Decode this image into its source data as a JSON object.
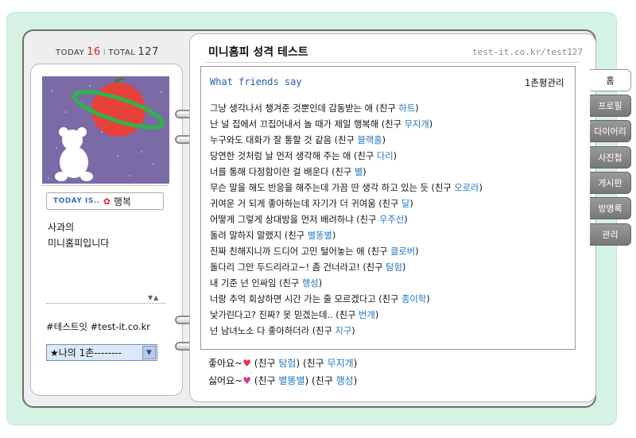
{
  "counter": {
    "today_label": "TODAY",
    "today_value": "16",
    "separator": "I",
    "total_label": "TOTAL",
    "total_value": "127"
  },
  "profile": {
    "today_is_label": "TODAY IS..",
    "mood_icon": "flower-icon",
    "mood": "행복",
    "intro_line1": "사과의",
    "intro_line2": "미니홈피입니다",
    "arrows": "▼▲",
    "tags": "#테스트잇 #test-it.co.kr",
    "ilchon_select": "★나의 1촌--------"
  },
  "header": {
    "title": "미니홈피 성격 테스트",
    "url": "test-it.co.kr/test127"
  },
  "main": {
    "section_title": "What friends say",
    "review_link": "1촌평관리",
    "lines": [
      {
        "text": "그냥 생각나서 챙겨준 것뿐인데 감동받는 애 (친구 ",
        "friend": "하트",
        "end": ")"
      },
      {
        "text": "난 널 집에서 끄집어내서 놀 때가 제일 행복해 (친구 ",
        "friend": "무지개",
        "end": ")"
      },
      {
        "text": "누구와도 대화가 잘 통할 것 같음 (친구 ",
        "friend": "블랙홀",
        "end": ")"
      },
      {
        "text": "당연한 것처럼 날 먼저 생각해 주는 애 (친구 ",
        "friend": "다리",
        "end": ")"
      },
      {
        "text": "너를 통해 다정함이란 걸 배운다 (친구 ",
        "friend": "별",
        "end": ")"
      },
      {
        "text": "무슨 말을 해도 반응을 해주는데 가끔 딴 생각 하고 있는 듯 (친구 ",
        "friend": "오로라",
        "end": ")"
      },
      {
        "text": "귀여운 거 되게 좋아하는데 자기가 더 귀여움 (친구 ",
        "friend": "달",
        "end": ")"
      },
      {
        "text": "어떻게 그렇게 상대방을 먼저 배려하냐 (친구 ",
        "friend": "우주선",
        "end": ")"
      },
      {
        "text": "돌려 말하지 말랬지 (친구 ",
        "friend": "별똥별",
        "end": ")"
      },
      {
        "text": "진짜 친해지니까 드디어 고민 털어놓는 애 (친구 ",
        "friend": "클로버",
        "end": ")"
      },
      {
        "text": "돌다리 그만 두드리라고~! 좀 건너라고! (친구 ",
        "friend": "탐험",
        "end": ")"
      },
      {
        "text": "내 기준 넌 인싸임 (친구 ",
        "friend": "행성",
        "end": ")"
      },
      {
        "text": "너랑 추억 회상하면 시간 가는 줄 모르겠다고 (친구 ",
        "friend": "종이학",
        "end": ")"
      },
      {
        "text": "낯가린다고? 진짜? 못 믿겠는데.. (친구 ",
        "friend": "번개",
        "end": ")"
      },
      {
        "text": "넌 남녀노소 다 좋아하더라 (친구 ",
        "friend": "지구",
        "end": ")"
      }
    ],
    "like_label": "좋아요~",
    "like_icon": "heart-icon",
    "like_pre1": " (친구 ",
    "like_friend1": "탐험",
    "like_mid": ") (친구 ",
    "like_friend2": "무지개",
    "like_end": ")",
    "dislike_label": "싫어요~",
    "dislike_icon": "broken-heart-icon",
    "dislike_pre1": " (친구 ",
    "dislike_friend1": "별똥별",
    "dislike_mid": ") (친구 ",
    "dislike_friend2": "행성",
    "dislike_end": ")"
  },
  "tabs": [
    "홈",
    "프로필",
    "다이어리",
    "사진첩",
    "게시판",
    "방명록",
    "관리"
  ],
  "colors": {
    "background": "#d5f3e2",
    "friend_link": "#1f76c2",
    "accent_red": "#d8232a",
    "title_blue": "#2a5bab"
  }
}
